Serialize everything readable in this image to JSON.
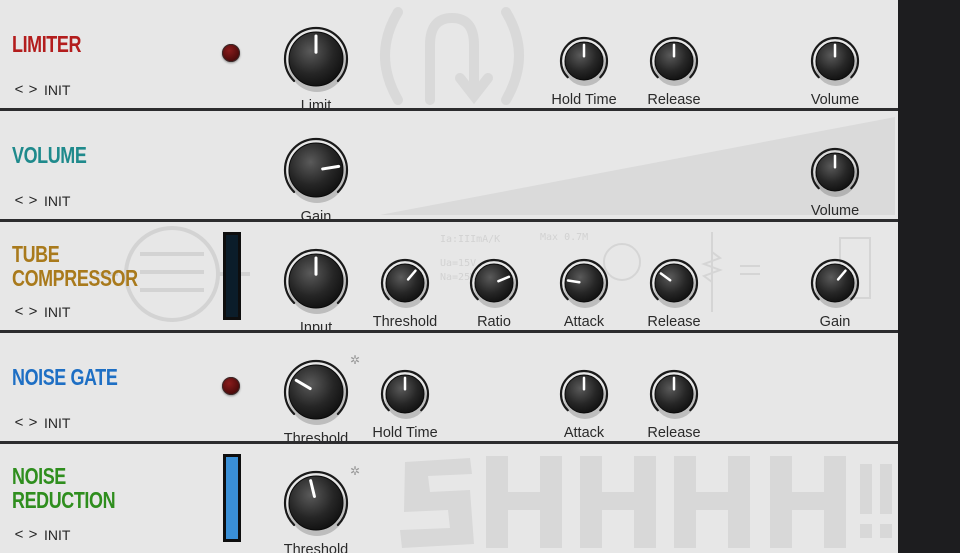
{
  "colors": {
    "limiter": "#b31d1d",
    "volume": "#1f8a8c",
    "tube_compressor": "#a97a1c",
    "noise_gate": "#1e6fc4",
    "noise_reduction": "#2f8e1e"
  },
  "modules": [
    {
      "id": "limiter",
      "title_lines": [
        "LIMITER"
      ],
      "preset_prev": "<",
      "preset_next": ">",
      "preset": "INIT",
      "knobs": [
        {
          "label": "Limit",
          "value": 0.5,
          "size": "big"
        },
        {
          "label": "Hold Time",
          "value": 0.5,
          "size": "small"
        },
        {
          "label": "Release",
          "value": 0.5,
          "size": "small"
        },
        {
          "label": "Volume",
          "value": 0.5,
          "size": "small"
        }
      ]
    },
    {
      "id": "volume",
      "title_lines": [
        "VOLUME"
      ],
      "preset_prev": "<",
      "preset_next": ">",
      "preset": "INIT",
      "knobs": [
        {
          "label": "Gain",
          "value": 0.8,
          "size": "big"
        },
        {
          "label": "Volume",
          "value": 0.5,
          "size": "small"
        }
      ]
    },
    {
      "id": "tube_compressor",
      "title_lines": [
        "TUBE",
        "COMPRESSOR"
      ],
      "preset_prev": "<",
      "preset_next": ">",
      "preset": "INIT",
      "knobs": [
        {
          "label": "Input",
          "value": 0.5,
          "size": "big"
        },
        {
          "label": "Threshold",
          "value": 0.65,
          "size": "small"
        },
        {
          "label": "Ratio",
          "value": 0.75,
          "size": "small"
        },
        {
          "label": "Attack",
          "value": 0.2,
          "size": "small"
        },
        {
          "label": "Release",
          "value": 0.3,
          "size": "small"
        },
        {
          "label": "Gain",
          "value": 0.65,
          "size": "small"
        }
      ]
    },
    {
      "id": "noise_gate",
      "title_lines": [
        "NOISE GATE"
      ],
      "preset_prev": "<",
      "preset_next": ">",
      "preset": "INIT",
      "knobs": [
        {
          "label": "Threshold",
          "value": 0.28,
          "size": "big"
        },
        {
          "label": "Hold Time",
          "value": 0.5,
          "size": "small"
        },
        {
          "label": "Attack",
          "value": 0.5,
          "size": "small"
        },
        {
          "label": "Release",
          "value": 0.5,
          "size": "small"
        }
      ]
    },
    {
      "id": "noise_reduction",
      "title_lines": [
        "NOISE",
        "REDUCTION"
      ],
      "preset_prev": "<",
      "preset_next": ">",
      "preset": "INIT",
      "knobs": [
        {
          "label": "Threshold",
          "value": 0.45,
          "size": "big"
        }
      ]
    }
  ]
}
